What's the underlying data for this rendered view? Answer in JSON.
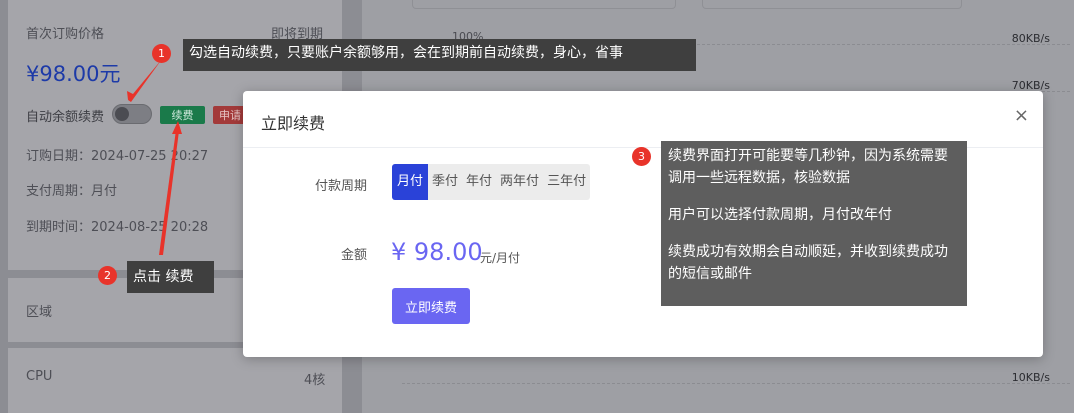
{
  "background": {
    "first_purchase_label": "首次订购价格",
    "expire_status": "即将到期",
    "price": "¥98.00元",
    "auto_renew_label": "自动余额续费",
    "renew_button": "续费",
    "apply_button": "申请",
    "order_date": "订购日期：2024-07-25 20:27",
    "pay_cycle": "支付周期：月付",
    "expire_time": "到期时间：2024-08-25 20:28",
    "region_label": "区域",
    "cpu_label": "CPU",
    "cpu_value": "4核",
    "chart_top_label": "100%",
    "y_labels": [
      "80KB/s",
      "70KB/s",
      "10KB/s"
    ]
  },
  "modal": {
    "title": "立即续费",
    "close": "×",
    "period_label": "付款周期",
    "periods": [
      "月付",
      "季付",
      "年付",
      "两年付",
      "三年付"
    ],
    "selected_period": "月付",
    "amount_label": "金额",
    "amount": "¥ 98.00",
    "amount_unit": "元/月付",
    "renew_button": "立即续费"
  },
  "annotations": [
    {
      "number": "1",
      "text": "勾选自动续费，只要账户余额够用，会在到期前自动续费，身心，省事"
    },
    {
      "number": "2",
      "text": "点击 续费"
    },
    {
      "number": "3",
      "paragraphs": [
        "续费界面打开可能要等几秒钟，因为系统需要调用一些远程数据，核验数据",
        "用户可以选择付款周期，月付改年付",
        "续费成功有效期会自动顺延，并收到续费成功的短信或邮件"
      ]
    }
  ],
  "colors": {
    "primary": "#6a66f2",
    "active_tab": "#2a42d8",
    "badge": "#e8332a",
    "renew_green": "#1a7a4a",
    "apply_red": "#a33a3a"
  }
}
